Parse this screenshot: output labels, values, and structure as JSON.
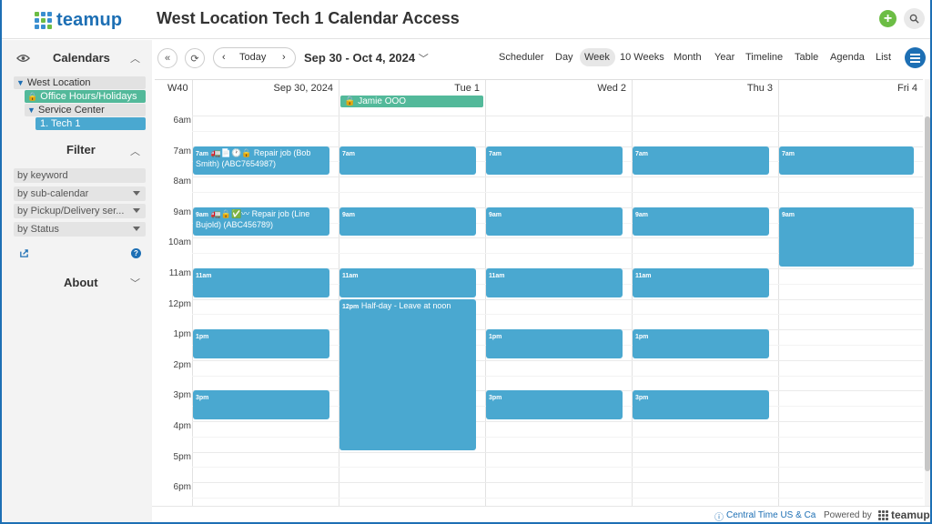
{
  "app": {
    "logo_text": "teamup",
    "title": "West Location Tech 1 Calendar Access"
  },
  "sidebar": {
    "calendars_header": "Calendars",
    "calendars": [
      {
        "label": "West Location",
        "type": "folder"
      },
      {
        "label": "Office Hours/Holidays",
        "type": "locked",
        "color": "#53b99a"
      },
      {
        "label": "Service Center",
        "type": "folder"
      },
      {
        "label": "1. Tech 1",
        "type": "selected",
        "color": "#4aa8d0"
      }
    ],
    "filter_header": "Filter",
    "filters": [
      {
        "label": "by keyword",
        "dropdown": false
      },
      {
        "label": "by sub-calendar",
        "dropdown": true
      },
      {
        "label": "by Pickup/Delivery ser...",
        "dropdown": true
      },
      {
        "label": "by Status",
        "dropdown": true
      }
    ],
    "about_header": "About",
    "help_icon": "?"
  },
  "toolbar": {
    "today_label": "Today",
    "date_range": "Sep 30 - Oct 4, 2024",
    "views": [
      "Scheduler",
      "Day",
      "Week",
      "10 Weeks",
      "Month",
      "Year",
      "Timeline",
      "Table",
      "Agenda",
      "List"
    ],
    "active_view": "Week"
  },
  "calendar": {
    "week_label": "W40",
    "days": [
      "Sep 30, 2024",
      "Tue 1",
      "Wed 2",
      "Thu 3",
      "Fri 4"
    ],
    "hours": [
      "6am",
      "7am",
      "8am",
      "9am",
      "10am",
      "11am",
      "12pm",
      "1pm",
      "2pm",
      "3pm",
      "4pm",
      "5pm",
      "6pm"
    ],
    "allday_events": [
      {
        "day": 1,
        "title": "Jamie OOO"
      }
    ],
    "events": [
      {
        "day": 0,
        "start": 7,
        "end": 8,
        "time": "7am",
        "title": "Repair job (Bob Smith) (ABC7654987)",
        "icons": "🚛📄🕐🔒"
      },
      {
        "day": 1,
        "start": 7,
        "end": 8,
        "time": "7am",
        "title": "",
        "icons": ""
      },
      {
        "day": 2,
        "start": 7,
        "end": 8,
        "time": "7am",
        "title": "",
        "icons": ""
      },
      {
        "day": 3,
        "start": 7,
        "end": 8,
        "time": "7am",
        "title": "",
        "icons": ""
      },
      {
        "day": 4,
        "start": 7,
        "end": 8,
        "time": "7am",
        "title": "",
        "icons": ""
      },
      {
        "day": 0,
        "start": 9,
        "end": 10,
        "time": "9am",
        "title": "Repair job (Line Bujold) (ABC456789)",
        "icons": "🚛🔒✅〰"
      },
      {
        "day": 1,
        "start": 9,
        "end": 10,
        "time": "9am",
        "title": "",
        "icons": ""
      },
      {
        "day": 2,
        "start": 9,
        "end": 10,
        "time": "9am",
        "title": "",
        "icons": ""
      },
      {
        "day": 3,
        "start": 9,
        "end": 10,
        "time": "9am",
        "title": "",
        "icons": ""
      },
      {
        "day": 4,
        "start": 9,
        "end": 11,
        "time": "9am",
        "title": "",
        "icons": ""
      },
      {
        "day": 0,
        "start": 11,
        "end": 12,
        "time": "11am",
        "title": "",
        "icons": ""
      },
      {
        "day": 1,
        "start": 11,
        "end": 12,
        "time": "11am",
        "title": "",
        "icons": ""
      },
      {
        "day": 2,
        "start": 11,
        "end": 12,
        "time": "11am",
        "title": "",
        "icons": ""
      },
      {
        "day": 3,
        "start": 11,
        "end": 12,
        "time": "11am",
        "title": "",
        "icons": ""
      },
      {
        "day": 1,
        "start": 12,
        "end": 17,
        "time": "12pm",
        "title": "Half-day - Leave at noon",
        "icons": ""
      },
      {
        "day": 0,
        "start": 13,
        "end": 14,
        "time": "1pm",
        "title": "",
        "icons": ""
      },
      {
        "day": 2,
        "start": 13,
        "end": 14,
        "time": "1pm",
        "title": "",
        "icons": ""
      },
      {
        "day": 3,
        "start": 13,
        "end": 14,
        "time": "1pm",
        "title": "",
        "icons": ""
      },
      {
        "day": 0,
        "start": 15,
        "end": 16,
        "time": "3pm",
        "title": "",
        "icons": ""
      },
      {
        "day": 2,
        "start": 15,
        "end": 16,
        "time": "3pm",
        "title": "",
        "icons": ""
      },
      {
        "day": 3,
        "start": 15,
        "end": 16,
        "time": "3pm",
        "title": "",
        "icons": ""
      }
    ]
  },
  "footer": {
    "timezone": "Central Time US & Ca",
    "powered_by": "Powered by",
    "brand": "teamup"
  },
  "colors": {
    "accent": "#1d6fb4",
    "event": "#4aa8d0",
    "office": "#53b99a",
    "add": "#6cbd45"
  }
}
